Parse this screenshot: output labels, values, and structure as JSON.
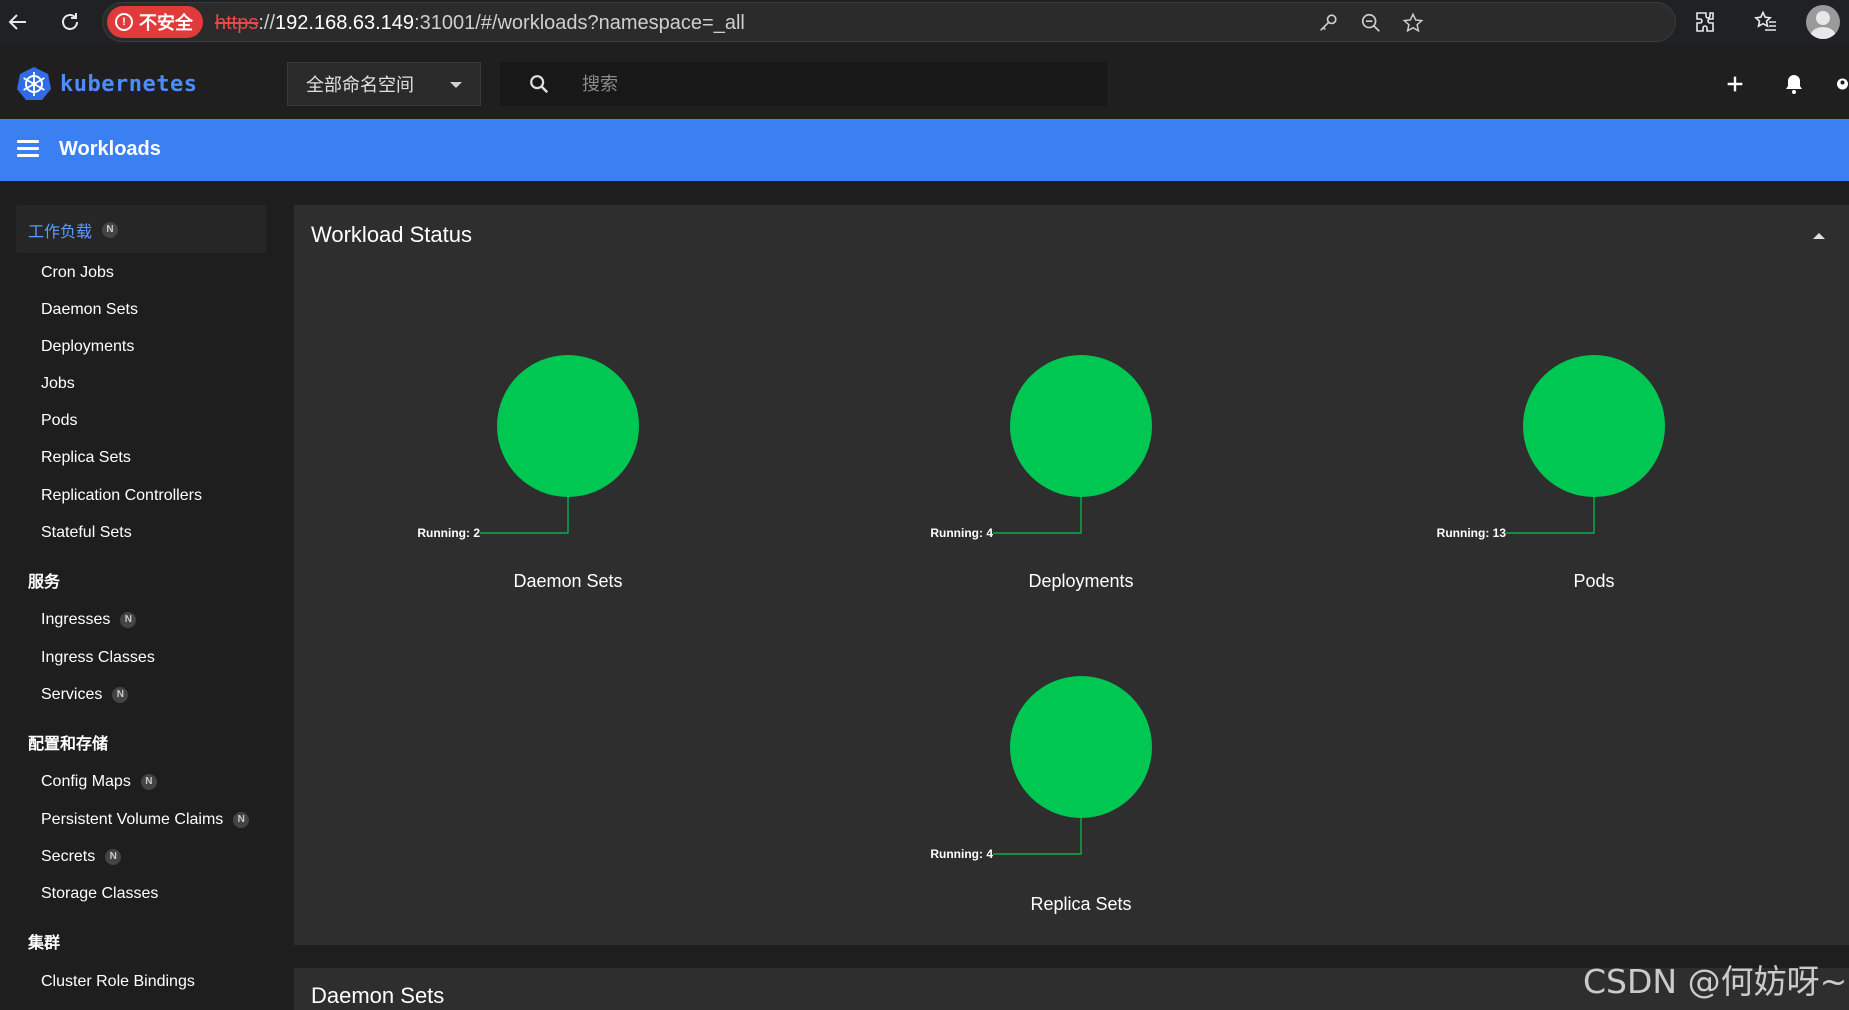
{
  "browser": {
    "insecure_label": "不安全",
    "url_scheme": "https",
    "url_sep": "://",
    "url_host": "192.168.63.149",
    "url_rest": ":31001/#/workloads?namespace=_all"
  },
  "header": {
    "logo_text": "kubernetes",
    "namespace_selected": "全部命名空间",
    "search_placeholder": "搜索"
  },
  "titlebar": {
    "title": "Workloads"
  },
  "sidebar": {
    "groups": [
      {
        "label": "工作负载",
        "badge": "N"
      },
      {
        "label": "服务"
      },
      {
        "label": "配置和存储"
      },
      {
        "label": "集群"
      }
    ],
    "workload_items": [
      {
        "label": "Cron Jobs"
      },
      {
        "label": "Daemon Sets"
      },
      {
        "label": "Deployments"
      },
      {
        "label": "Jobs"
      },
      {
        "label": "Pods"
      },
      {
        "label": "Replica Sets"
      },
      {
        "label": "Replication Controllers"
      },
      {
        "label": "Stateful Sets"
      }
    ],
    "service_items": [
      {
        "label": "Ingresses",
        "badge": "N"
      },
      {
        "label": "Ingress Classes"
      },
      {
        "label": "Services",
        "badge": "N"
      }
    ],
    "config_items": [
      {
        "label": "Config Maps",
        "badge": "N"
      },
      {
        "label": "Persistent Volume Claims",
        "badge": "N"
      },
      {
        "label": "Secrets",
        "badge": "N"
      },
      {
        "label": "Storage Classes"
      }
    ],
    "cluster_items": [
      {
        "label": "Cluster Role Bindings"
      }
    ]
  },
  "workload_status": {
    "title": "Workload Status",
    "charts": [
      {
        "name": "Daemon Sets",
        "running_label": "Running: 2",
        "running": 2
      },
      {
        "name": "Deployments",
        "running_label": "Running: 4",
        "running": 4
      },
      {
        "name": "Pods",
        "running_label": "Running: 13",
        "running": 13
      },
      {
        "name": "Replica Sets",
        "running_label": "Running: 4",
        "running": 4
      }
    ],
    "running_color": "#00c752"
  },
  "next_card": {
    "title": "Daemon Sets"
  },
  "watermark": "CSDN @何妨呀~"
}
